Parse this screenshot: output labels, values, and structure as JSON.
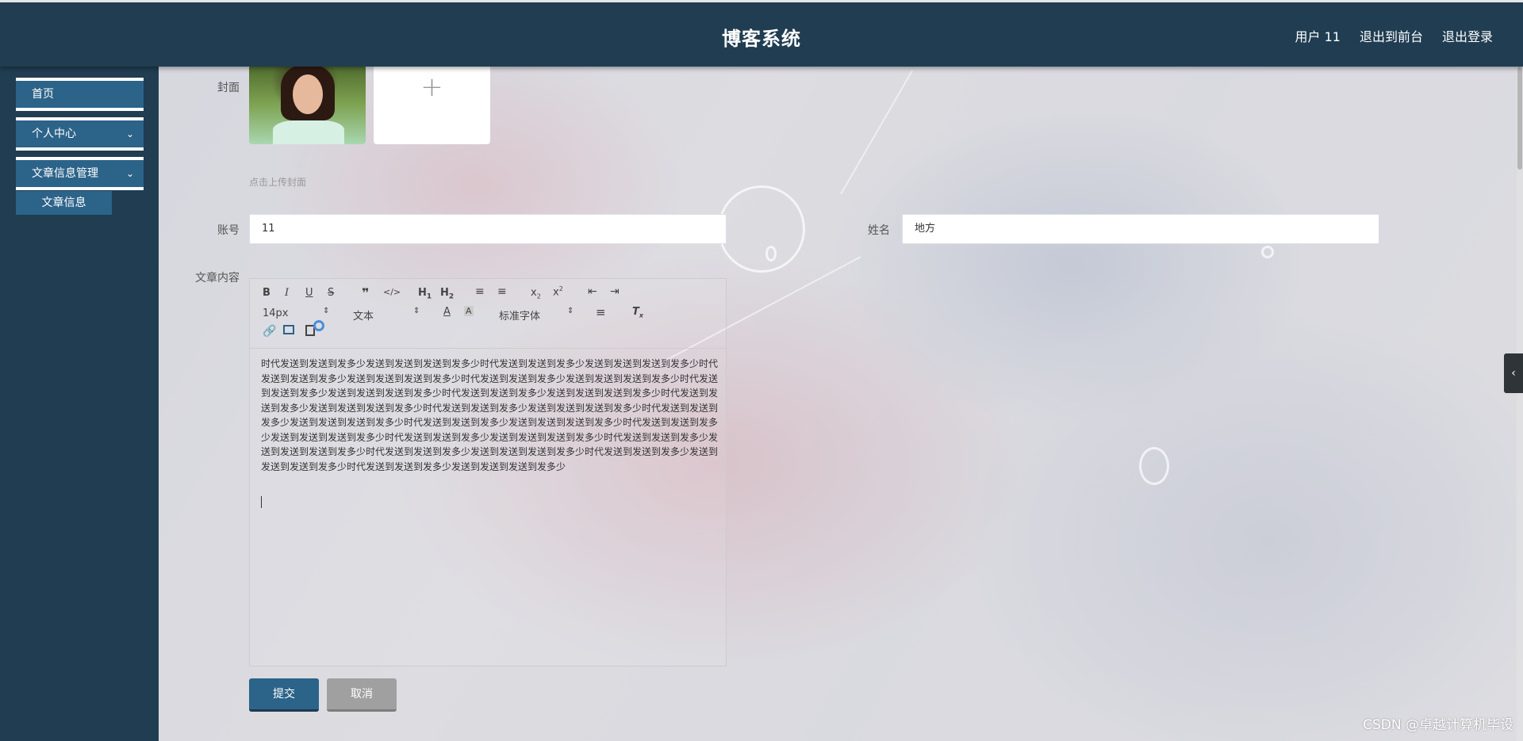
{
  "header": {
    "title": "博客系统",
    "user_label": "用户 11",
    "front_label": "退出到前台",
    "logout_label": "退出登录"
  },
  "sidebar": {
    "items": [
      {
        "label": "首页",
        "has_arrow": false
      },
      {
        "label": "个人中心",
        "has_arrow": true
      },
      {
        "label": "文章信息管理",
        "has_arrow": true
      }
    ],
    "sub_item": "文章信息"
  },
  "form": {
    "cover_label": "封面",
    "upload_hint": "点击上传封面",
    "account_label": "账号",
    "account_value": "11",
    "name_label": "姓名",
    "name_value": "地方",
    "content_label": "文章内容",
    "content_text": "时代发送到发送到发多少发送到发送到发送到发多少时代发送到发送到发多少发送到发送到发送到发多少时代发送到发送到发多少发送到发送到发送到发多少时代发送到发送到发多少发送到发送到发送到发多少时代发送到发送到发多少发送到发送到发送到发多少时代发送到发送到发多少发送到发送到发送到发多少时代发送到发送到发多少发送到发送到发送到发多少时代发送到发送到发多少发送到发送到发送到发多少时代发送到发送到发多少发送到发送到发送到发多少时代发送到发送到发多少发送到发送到发送到发多少时代发送到发送到发多少发送到发送到发送到发多少时代发送到发送到发多少发送到发送到发送到发多少时代发送到发送到发多少发送到发送到发送到发多少时代发送到发送到发多少发送到发送到发送到发多少时代发送到发送到发多少发送到发送到发送到发多少时代发送到发送到发多少发送到发送到发送到发多少",
    "submit_label": "提交",
    "cancel_label": "取消"
  },
  "toolbar": {
    "font_size": "14px",
    "text_type": "文本",
    "font_family": "标准字体"
  },
  "watermark": "CSDN @卓越计算机毕设",
  "colors": {
    "header_bg": "#203d52",
    "menu_bg": "#2c6389",
    "cancel_bg": "#a0a0a0"
  }
}
